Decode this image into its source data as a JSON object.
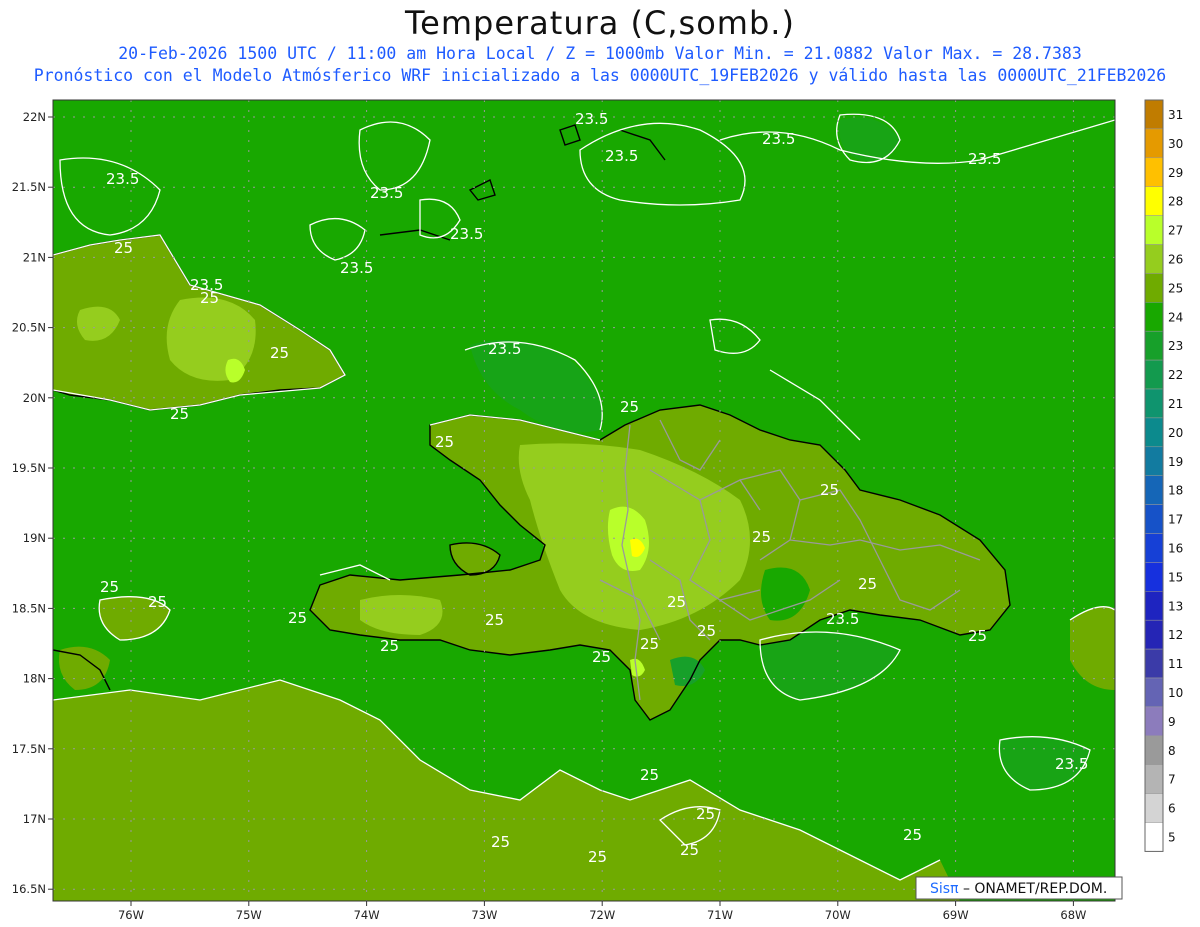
{
  "header": {
    "title": "Temperatura (C,somb.)",
    "line1": "20-Feb-2026 1500 UTC / 11:00 am Hora Local / Z = 1000mb   Valor Min. = 21.0882  Valor Max. = 28.7383",
    "line2": "Pronóstico con el Modelo Atmósferico WRF inicializado a las 0000UTC_19FEB2026 y válido hasta las  0000UTC_21FEB2026"
  },
  "map": {
    "lat_ticks": [
      "22N",
      "21.5N",
      "21N",
      "20.5N",
      "20N",
      "19.5N",
      "19N",
      "18.5N",
      "18N",
      "17.5N",
      "17N",
      "16.5N"
    ],
    "lon_ticks": [
      "76W",
      "75W",
      "74W",
      "73W",
      "72W",
      "71W",
      "70W",
      "69W",
      "68W"
    ],
    "contour_labels": [
      "23.5",
      "25"
    ],
    "credit": {
      "logo": "Sisπ",
      "text": " – ONAMET/REP.DOM."
    }
  },
  "legend": {
    "values": [
      "31",
      "30",
      "29",
      "28",
      "27",
      "26",
      "25",
      "24",
      "23",
      "22",
      "21",
      "20",
      "19",
      "18",
      "17",
      "16",
      "15",
      "13",
      "12",
      "11",
      "10",
      "9",
      "8",
      "7",
      "6",
      "5"
    ],
    "colors": [
      "#c07c00",
      "#e59a00",
      "#ffc000",
      "#ffff00",
      "#b9ff2a",
      "#95cd1e",
      "#6fab00",
      "#18a800",
      "#17a02a",
      "#139a4e",
      "#0f946e",
      "#0c8a8d",
      "#127ba0",
      "#1566b7",
      "#1652c8",
      "#1640d6",
      "#1630de",
      "#1e24c0",
      "#2525b5",
      "#3b3ba8",
      "#6464b4",
      "#8c7cbc",
      "#9a9a9a",
      "#b4b4b4",
      "#d4d4d4",
      "#ffffff"
    ]
  }
}
